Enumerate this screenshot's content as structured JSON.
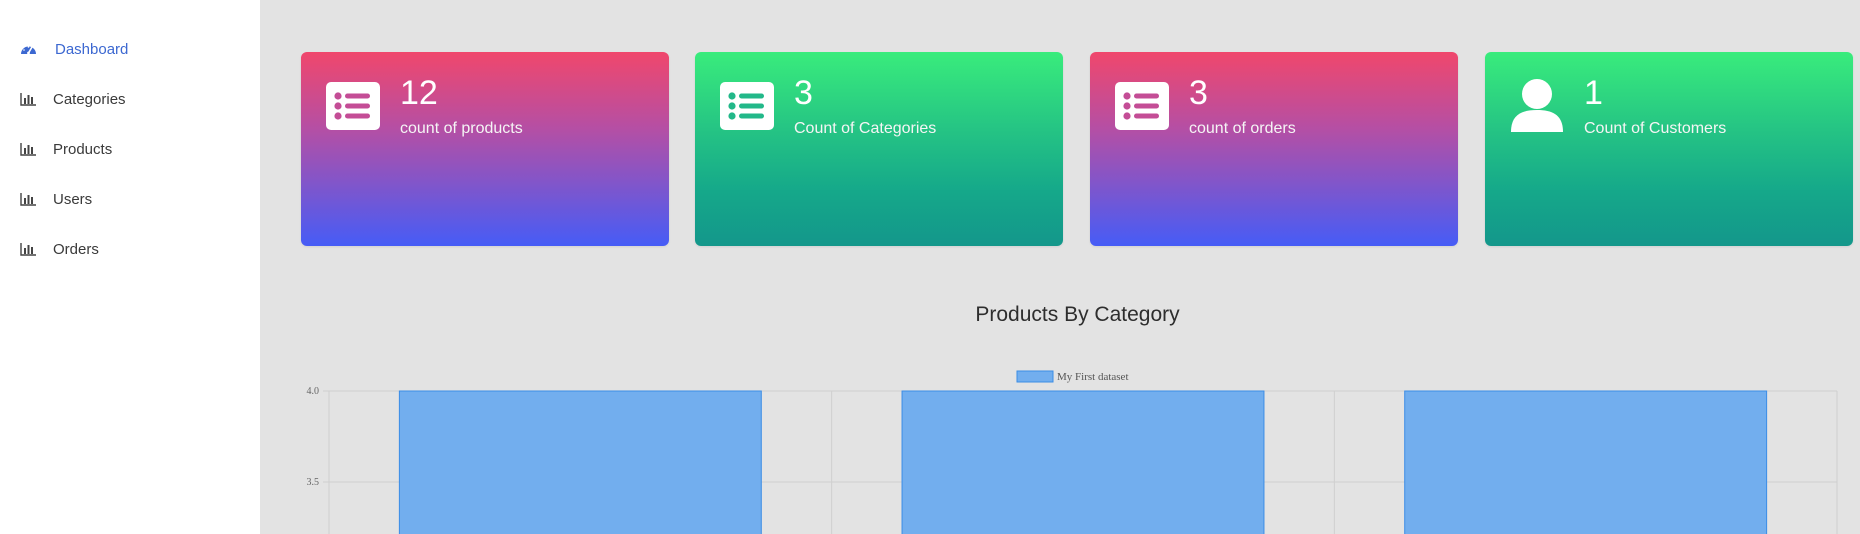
{
  "sidebar": {
    "items": [
      {
        "label": "Dashboard",
        "icon": "dashboard-gauge-icon",
        "active": true
      },
      {
        "label": "Categories",
        "icon": "bar-chart-icon",
        "active": false
      },
      {
        "label": "Products",
        "icon": "bar-chart-icon",
        "active": false
      },
      {
        "label": "Users",
        "icon": "bar-chart-icon",
        "active": false
      },
      {
        "label": "Orders",
        "icon": "bar-chart-icon",
        "active": false
      }
    ]
  },
  "cards": [
    {
      "value": "12",
      "label": "count of products",
      "icon": "list-icon",
      "theme": "pink"
    },
    {
      "value": "3",
      "label": "Count of Categories",
      "icon": "list-icon",
      "theme": "green"
    },
    {
      "value": "3",
      "label": "count of orders",
      "icon": "list-icon",
      "theme": "pink"
    },
    {
      "value": "1",
      "label": "Count of Customers",
      "icon": "user-icon",
      "theme": "green"
    }
  ],
  "colors": {
    "accent": "#3c68d1",
    "pink_top": "#f0476c",
    "pink_bottom": "#465cf6",
    "green_top": "#39ec7c",
    "green_bottom": "#14978b",
    "bar_fill": "#72aeee",
    "bar_stroke": "#3b8de6"
  },
  "chart": {
    "title": "Products By Category"
  },
  "chart_data": {
    "type": "bar",
    "title": "Products By Category",
    "legend_position": "top-center",
    "grid": true,
    "series": [
      {
        "name": "My First dataset",
        "values": [
          4,
          4,
          4
        ]
      }
    ],
    "yticks": [
      "4.0",
      "3.5"
    ],
    "ylim_visible": [
      3.2,
      4.0
    ]
  }
}
